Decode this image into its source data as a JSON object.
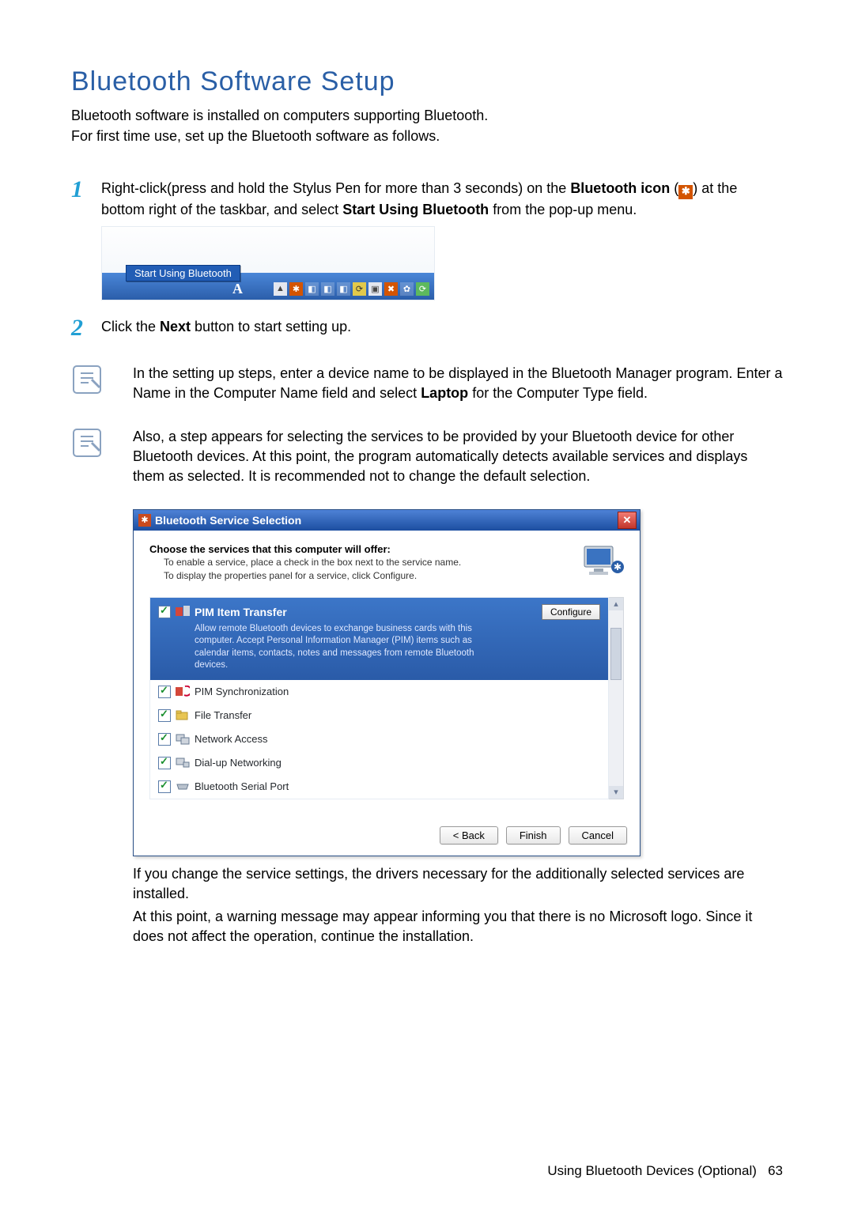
{
  "heading": "Bluetooth Software Setup",
  "intro_line1": "Bluetooth software is installed on computers supporting Bluetooth.",
  "intro_line2": "For first time use, set up the Bluetooth software as follows.",
  "steps": {
    "s1_num": "1",
    "s1_a": "Right-click(press and hold the Stylus Pen for more than 3 seconds) on the ",
    "s1_bold1": "Bluetooth icon",
    "s1_b": " (",
    "s1_c": ") at the bottom right of the taskbar, and select ",
    "s1_bold2": "Start Using Bluetooth",
    "s1_d": " from the pop-up menu.",
    "s2_num": "2",
    "s2_a": "Click the ",
    "s2_bold": "Next",
    "s2_b": " button to start setting up."
  },
  "taskbar": {
    "menu_label": "Start Using Bluetooth",
    "lang_indicator": "A"
  },
  "note1": {
    "line": "In the setting up steps, enter a device name to be displayed in the Bluetooth Manager program. Enter a Name in the Computer Name field and select ",
    "bold1": "Laptop",
    "rest": " for the Computer Type field."
  },
  "note2": "Also, a step appears for selecting the services to be provided by your Bluetooth device for other Bluetooth devices. At this point, the program automatically detects available services and displays them as selected. It is recommended not to change the default selection.",
  "window": {
    "title": "Bluetooth Service Selection",
    "choose_head": "Choose the services that this computer will offer:",
    "choose_sub1": "To enable a service, place a check in the box next to the service name.",
    "choose_sub2": "To display the properties panel for a service, click Configure.",
    "highlight_title": "PIM Item Transfer",
    "highlight_desc": "Allow remote Bluetooth devices to exchange business cards with this computer. Accept Personal Information Manager (PIM) items such as calendar items, contacts, notes and messages from remote Bluetooth devices.",
    "configure": "Configure",
    "services": [
      "PIM Synchronization",
      "File Transfer",
      "Network Access",
      "Dial-up Networking",
      "Bluetooth Serial Port"
    ],
    "buttons": {
      "back": "< Back",
      "finish": "Finish",
      "cancel": "Cancel"
    }
  },
  "after1": "If you change the service settings, the drivers necessary for the additionally selected services are installed.",
  "after2": "At this point, a warning message may appear informing you that there is no Microsoft logo. Since it does not affect the operation, continue the installation.",
  "footer": {
    "label": "Using Bluetooth Devices (Optional)",
    "page": "63"
  }
}
